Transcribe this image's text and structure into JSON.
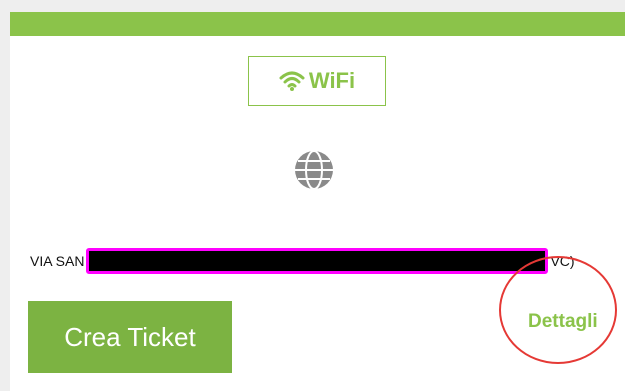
{
  "header": {
    "accent_color": "#8bc34a"
  },
  "badge": {
    "icon": "wifi-icon",
    "label": "WiFi"
  },
  "service": {
    "icon": "globe-icon"
  },
  "address": {
    "prefix": "VIA SAN",
    "suffix": "VC)"
  },
  "actions": {
    "primary_label": "Crea Ticket",
    "details_label": "Dettagli",
    "primary_color": "#7cb342"
  },
  "annotation": {
    "highlight_color": "#e53935"
  }
}
